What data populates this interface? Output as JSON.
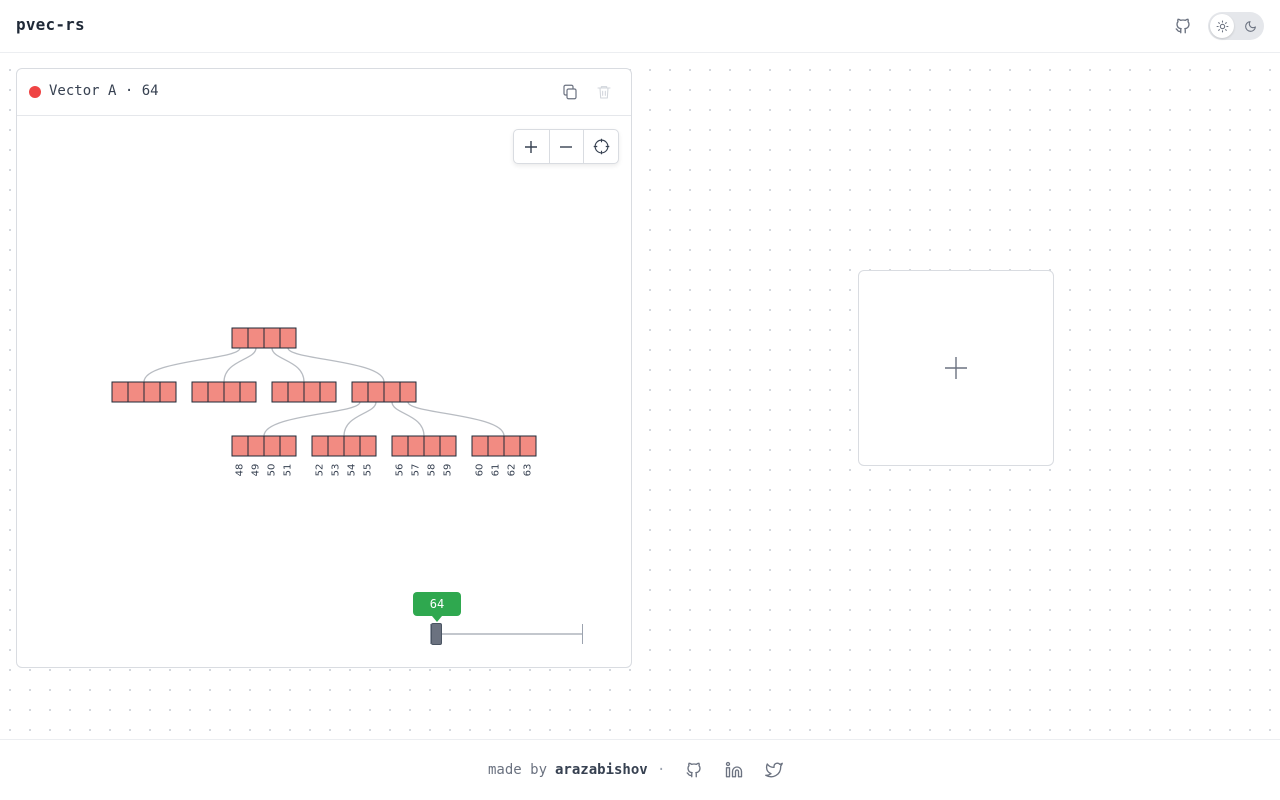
{
  "header": {
    "brand": "pvec-rs",
    "github_icon": "github-icon",
    "theme": {
      "light_icon": "sun-icon",
      "dark_icon": "moon-icon",
      "selected": "light"
    }
  },
  "vector_panel": {
    "title": "Vector A · 64",
    "dot_color": "#ef4444",
    "actions": [
      "copy-icon",
      "trash-icon"
    ],
    "zoom_controls": [
      "plus-icon",
      "minus-icon",
      "crosshair-icon"
    ],
    "tree": {
      "cell_color": "#f28b82",
      "cell_border": "#1f2937",
      "root_cells": 4,
      "level1_nodes": 4,
      "level2_expanded_from": 3,
      "leaf_labels": [
        [
          "48",
          "49",
          "50",
          "51"
        ],
        [
          "52",
          "53",
          "54",
          "55"
        ],
        [
          "56",
          "57",
          "58",
          "59"
        ],
        [
          "60",
          "61",
          "62",
          "63"
        ]
      ]
    },
    "slider": {
      "value": "64",
      "tooltip_color": "#2fa84f"
    }
  },
  "add_panel": {
    "icon": "plus-icon"
  },
  "footer": {
    "made_by": "made by",
    "author": "arazabishov",
    "separator": "·",
    "links": [
      "github-icon",
      "linkedin-icon",
      "twitter-icon"
    ]
  }
}
